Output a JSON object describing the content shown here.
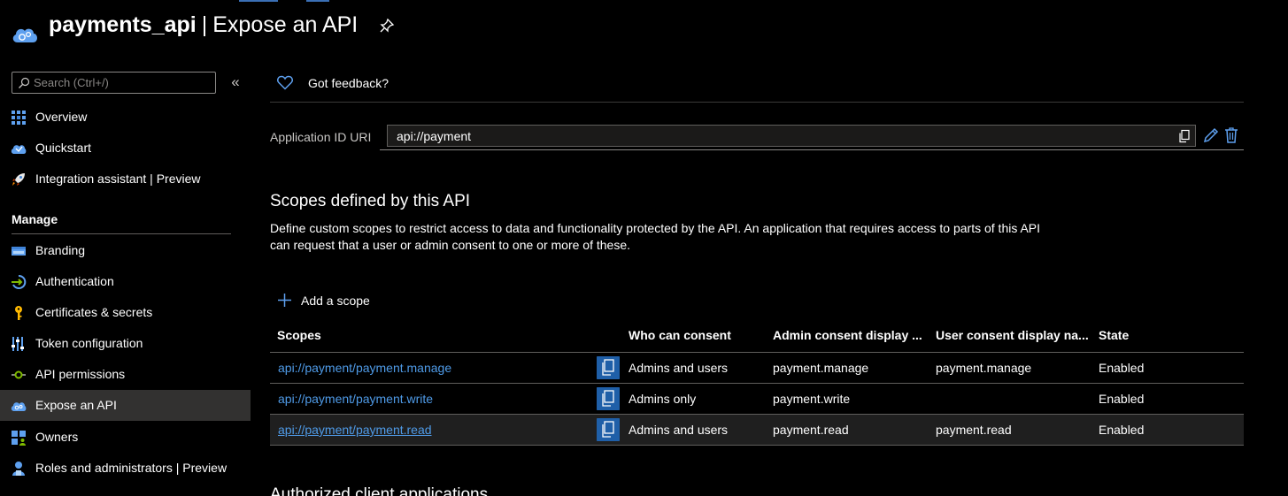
{
  "header": {
    "resource_name": "payments_api",
    "separator": "|",
    "page_name": "Expose an API"
  },
  "sidebar": {
    "search_placeholder": "Search (Ctrl+/)",
    "collapse_glyph": "«",
    "items_top": [
      {
        "label": "Overview",
        "icon": "overview-grid-icon"
      },
      {
        "label": "Quickstart",
        "icon": "quickstart-cloud-icon"
      },
      {
        "label": "Integration assistant | Preview",
        "icon": "rocket-icon"
      }
    ],
    "manage_header": "Manage",
    "items_manage": [
      {
        "label": "Branding",
        "icon": "branding-icon"
      },
      {
        "label": "Authentication",
        "icon": "authentication-icon"
      },
      {
        "label": "Certificates & secrets",
        "icon": "key-icon"
      },
      {
        "label": "Token configuration",
        "icon": "token-bars-icon"
      },
      {
        "label": "API permissions",
        "icon": "api-permissions-icon"
      },
      {
        "label": "Expose an API",
        "icon": "expose-api-cloud-icon",
        "active": true
      },
      {
        "label": "Owners",
        "icon": "owners-icon"
      },
      {
        "label": "Roles and administrators | Preview",
        "icon": "roles-icon"
      }
    ]
  },
  "main": {
    "feedback_label": "Got feedback?",
    "app_id_label": "Application ID URI",
    "app_id_value": "api://payment",
    "scopes_title": "Scopes defined by this API",
    "scopes_description": "Define custom scopes to restrict access to data and functionality protected by the API. An application that requires access to parts of this API can request that a user or admin consent to one or more of these.",
    "add_scope_label": "Add a scope",
    "table": {
      "headers": [
        "Scopes",
        "Who can consent",
        "Admin consent display ...",
        "User consent display na...",
        "State"
      ],
      "rows": [
        {
          "scope": "api://payment/payment.manage",
          "who": "Admins and users",
          "admin": "payment.manage",
          "user": "payment.manage",
          "state": "Enabled"
        },
        {
          "scope": "api://payment/payment.write",
          "who": "Admins only",
          "admin": "payment.write",
          "user": "",
          "state": "Enabled"
        },
        {
          "scope": "api://payment/payment.read",
          "who": "Admins and users",
          "admin": "payment.read",
          "user": "payment.read",
          "state": "Enabled"
        }
      ]
    },
    "authorized_title": "Authorized client applications"
  },
  "colors": {
    "background": "#000000",
    "link": "#4f9be8",
    "accent": "#1f5fa8",
    "active_nav": "#323130"
  }
}
